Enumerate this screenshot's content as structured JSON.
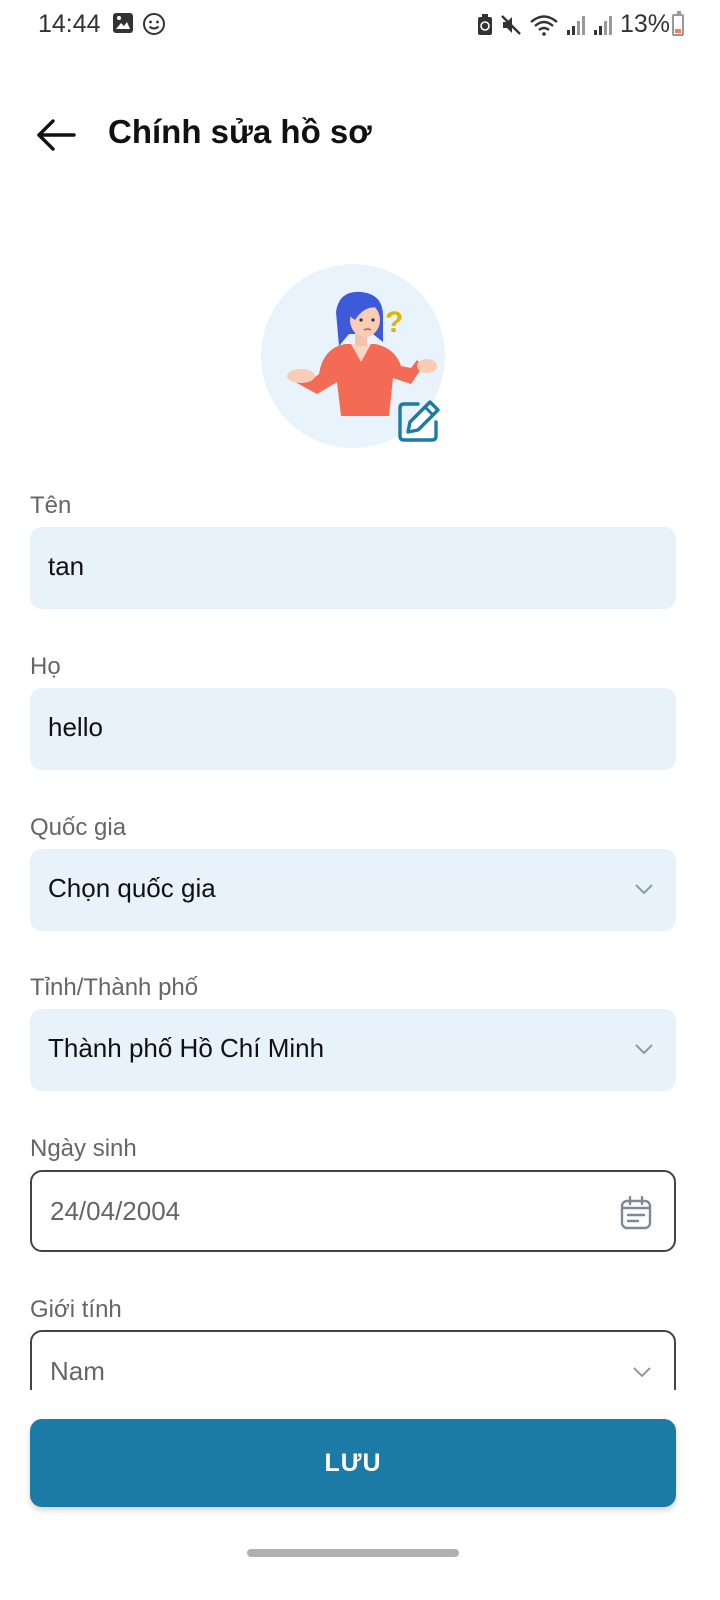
{
  "status_bar": {
    "time": "14:44",
    "battery": "13%",
    "icons": [
      "image-icon",
      "smiley-icon",
      "battery-saver-icon",
      "mute-icon",
      "wifi-icon",
      "signal-icon",
      "signal-icon"
    ]
  },
  "header": {
    "title": "Chính sửa hồ sơ",
    "back_icon": "arrow-left-icon"
  },
  "avatar": {
    "edit_icon": "edit-icon"
  },
  "form": {
    "first_name": {
      "label": "Tên",
      "value": "tan"
    },
    "last_name": {
      "label": "Họ",
      "value": "hello"
    },
    "country": {
      "label": "Quốc gia",
      "value": "Chọn quốc gia"
    },
    "city": {
      "label": "Tỉnh/Thành phố",
      "value": "Thành phố Hồ Chí Minh"
    },
    "birthday": {
      "label": "Ngày sinh",
      "value": "24/04/2004"
    },
    "gender": {
      "label": "Giới tính",
      "value": "Nam"
    }
  },
  "save_button": {
    "label": "LƯU"
  },
  "colors": {
    "accent": "#1c7ba5",
    "field_bg": "#e7f2fa",
    "avatar_bg": "#e8f3fb"
  }
}
